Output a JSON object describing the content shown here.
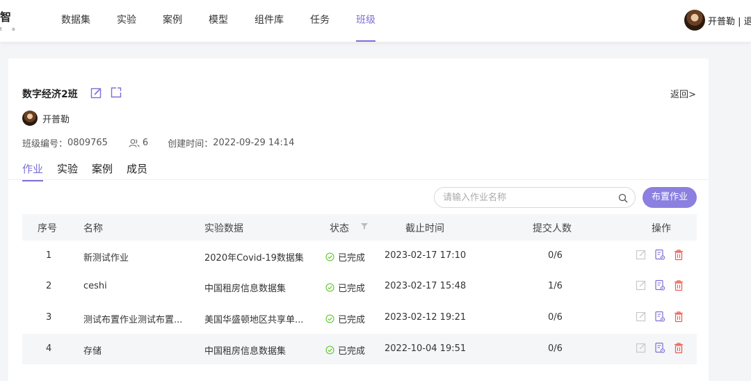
{
  "brand": {
    "logo_char": "智",
    "logo_sub": "t a"
  },
  "nav": {
    "items": [
      "数据集",
      "实验",
      "案例",
      "模型",
      "组件库",
      "任务",
      "班级"
    ],
    "active_index": 6
  },
  "user": {
    "display": "开普勒 | 退"
  },
  "class_info": {
    "title": "数字经济2班",
    "back_label": "返回>",
    "owner": "开普勒",
    "code_label": "班级编号：",
    "code": "0809765",
    "member_count": "6",
    "created_label": "创建时间：",
    "created": "2022-09-29 14:14"
  },
  "tabs": [
    "作业",
    "实验",
    "案例",
    "成员"
  ],
  "search": {
    "placeholder": "请输入作业名称"
  },
  "assign_button": "布置作业",
  "table": {
    "headers": {
      "index": "序号",
      "name": "名称",
      "dataset": "实验数据",
      "status": "状态",
      "deadline": "截止时间",
      "submitted": "提交人数",
      "actions": "操作"
    },
    "rows": [
      {
        "index": "1",
        "name": "新测试作业",
        "dataset": "2020年Covid-19数据集",
        "status": "已完成",
        "deadline": "2023-02-17 17:10",
        "submitted": "0/6"
      },
      {
        "index": "2",
        "name": "ceshi",
        "dataset": "中国租房信息数据集",
        "status": "已完成",
        "deadline": "2023-02-17 15:48",
        "submitted": "1/6"
      },
      {
        "index": "3",
        "name": "测试布置作业测试布置...",
        "dataset": "美国华盛顿地区共享单...",
        "status": "已完成",
        "deadline": "2023-02-12 19:21",
        "submitted": "0/6"
      },
      {
        "index": "4",
        "name": "存储",
        "dataset": "中国租房信息数据集",
        "status": "已完成",
        "deadline": "2022-10-04 19:51",
        "submitted": "0/6"
      }
    ]
  },
  "colors": {
    "accent": "#7b6fd6",
    "button": "#8b7fe0",
    "success": "#52c41a",
    "danger": "#f0584a",
    "muted_icon": "#c8c8c8"
  }
}
